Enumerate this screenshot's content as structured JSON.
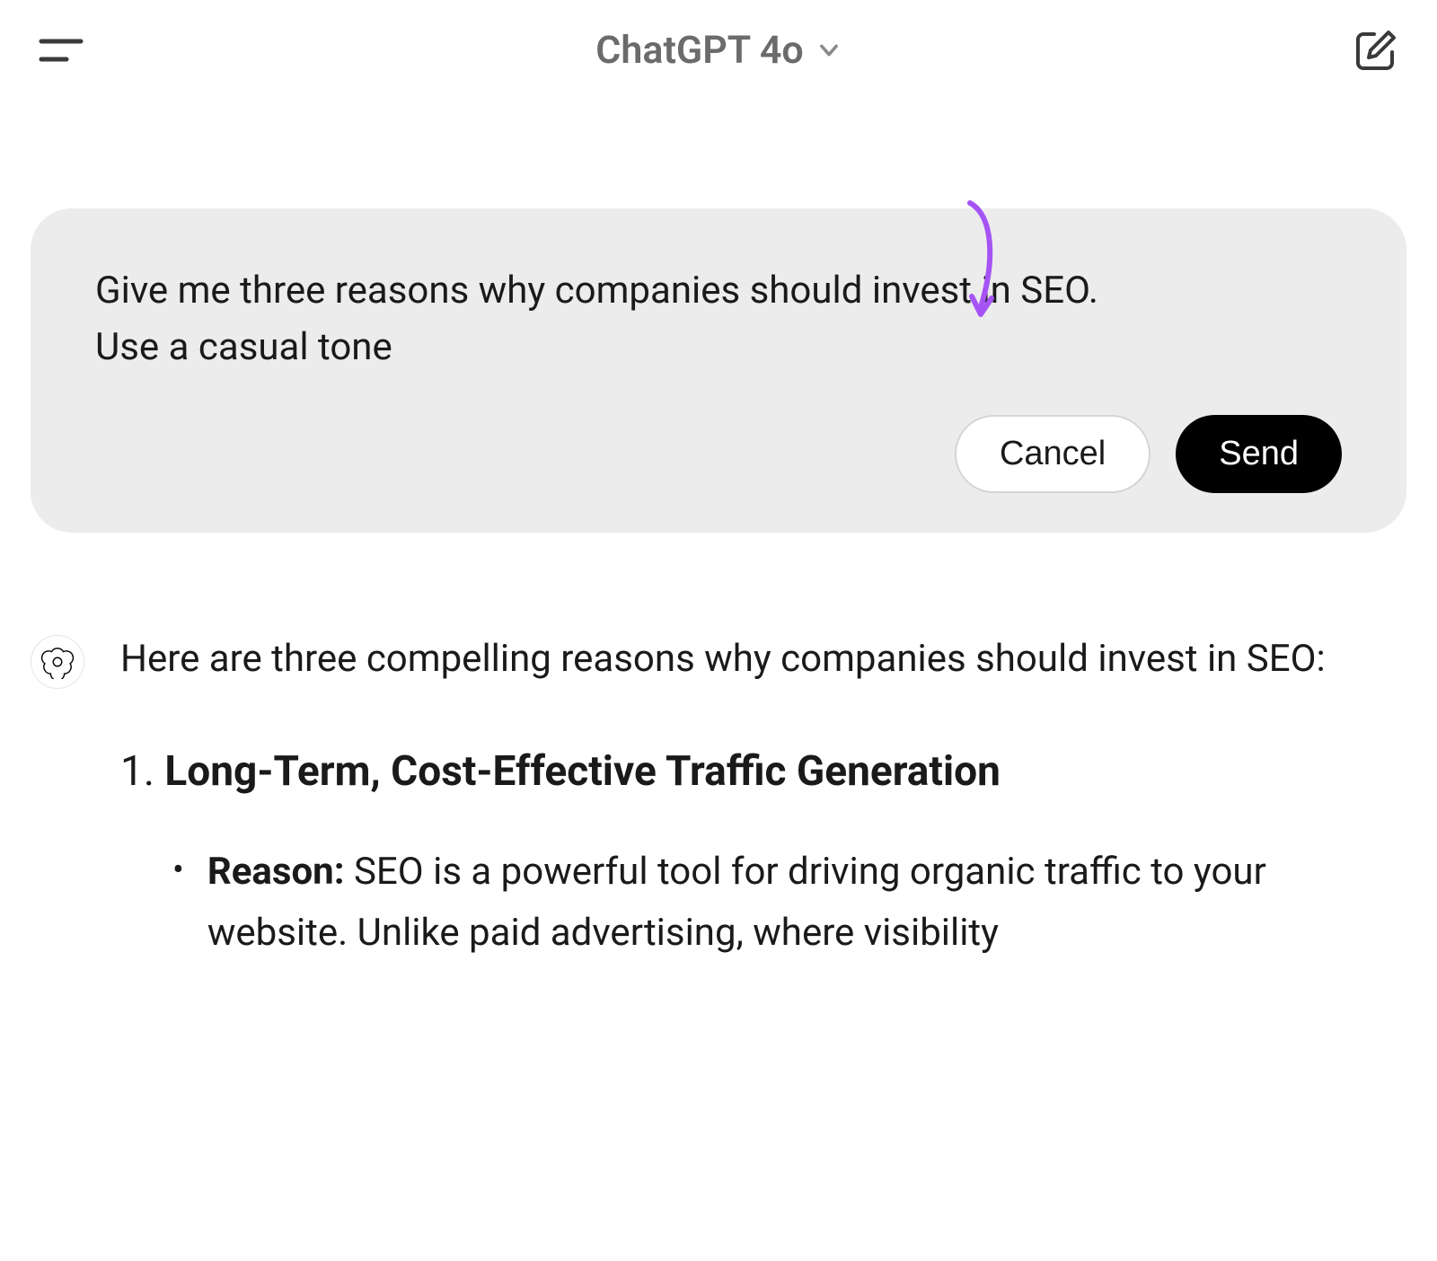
{
  "header": {
    "title": "ChatGPT 4o"
  },
  "edit": {
    "text": "Give me three reasons why companies should invest in SEO.\nUse a casual tone",
    "cancel_label": "Cancel",
    "send_label": "Send"
  },
  "response": {
    "intro": "Here are three compelling reasons why companies should invest in SEO:",
    "item1": {
      "number": "1.",
      "heading": "Long-Term, Cost-Effective Traffic Generation",
      "bullet_label": "Reason:",
      "bullet_text": " SEO is a powerful tool for driving organic traffic to your website. Unlike paid advertising, where visibility"
    }
  },
  "annotation": {
    "arrow_color": "#a553f5"
  }
}
